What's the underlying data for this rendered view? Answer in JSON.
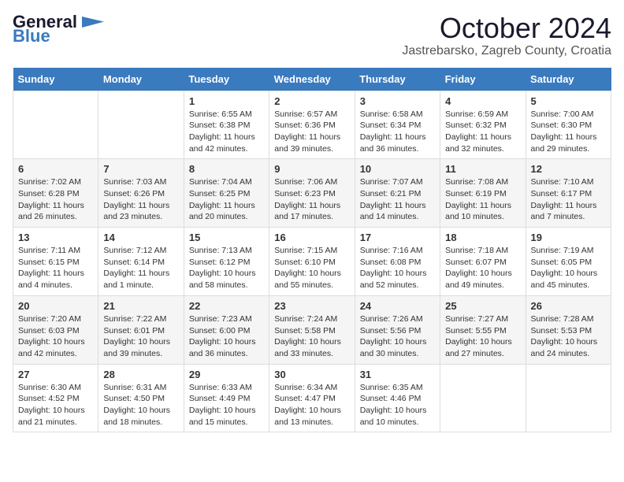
{
  "logo": {
    "line1": "General",
    "line2": "Blue"
  },
  "title": "October 2024",
  "subtitle": "Jastrebarsko, Zagreb County, Croatia",
  "days_of_week": [
    "Sunday",
    "Monday",
    "Tuesday",
    "Wednesday",
    "Thursday",
    "Friday",
    "Saturday"
  ],
  "weeks": [
    [
      {
        "day": "",
        "sunrise": "",
        "sunset": "",
        "daylight": ""
      },
      {
        "day": "",
        "sunrise": "",
        "sunset": "",
        "daylight": ""
      },
      {
        "day": "1",
        "sunrise": "Sunrise: 6:55 AM",
        "sunset": "Sunset: 6:38 PM",
        "daylight": "Daylight: 11 hours and 42 minutes."
      },
      {
        "day": "2",
        "sunrise": "Sunrise: 6:57 AM",
        "sunset": "Sunset: 6:36 PM",
        "daylight": "Daylight: 11 hours and 39 minutes."
      },
      {
        "day": "3",
        "sunrise": "Sunrise: 6:58 AM",
        "sunset": "Sunset: 6:34 PM",
        "daylight": "Daylight: 11 hours and 36 minutes."
      },
      {
        "day": "4",
        "sunrise": "Sunrise: 6:59 AM",
        "sunset": "Sunset: 6:32 PM",
        "daylight": "Daylight: 11 hours and 32 minutes."
      },
      {
        "day": "5",
        "sunrise": "Sunrise: 7:00 AM",
        "sunset": "Sunset: 6:30 PM",
        "daylight": "Daylight: 11 hours and 29 minutes."
      }
    ],
    [
      {
        "day": "6",
        "sunrise": "Sunrise: 7:02 AM",
        "sunset": "Sunset: 6:28 PM",
        "daylight": "Daylight: 11 hours and 26 minutes."
      },
      {
        "day": "7",
        "sunrise": "Sunrise: 7:03 AM",
        "sunset": "Sunset: 6:26 PM",
        "daylight": "Daylight: 11 hours and 23 minutes."
      },
      {
        "day": "8",
        "sunrise": "Sunrise: 7:04 AM",
        "sunset": "Sunset: 6:25 PM",
        "daylight": "Daylight: 11 hours and 20 minutes."
      },
      {
        "day": "9",
        "sunrise": "Sunrise: 7:06 AM",
        "sunset": "Sunset: 6:23 PM",
        "daylight": "Daylight: 11 hours and 17 minutes."
      },
      {
        "day": "10",
        "sunrise": "Sunrise: 7:07 AM",
        "sunset": "Sunset: 6:21 PM",
        "daylight": "Daylight: 11 hours and 14 minutes."
      },
      {
        "day": "11",
        "sunrise": "Sunrise: 7:08 AM",
        "sunset": "Sunset: 6:19 PM",
        "daylight": "Daylight: 11 hours and 10 minutes."
      },
      {
        "day": "12",
        "sunrise": "Sunrise: 7:10 AM",
        "sunset": "Sunset: 6:17 PM",
        "daylight": "Daylight: 11 hours and 7 minutes."
      }
    ],
    [
      {
        "day": "13",
        "sunrise": "Sunrise: 7:11 AM",
        "sunset": "Sunset: 6:15 PM",
        "daylight": "Daylight: 11 hours and 4 minutes."
      },
      {
        "day": "14",
        "sunrise": "Sunrise: 7:12 AM",
        "sunset": "Sunset: 6:14 PM",
        "daylight": "Daylight: 11 hours and 1 minute."
      },
      {
        "day": "15",
        "sunrise": "Sunrise: 7:13 AM",
        "sunset": "Sunset: 6:12 PM",
        "daylight": "Daylight: 10 hours and 58 minutes."
      },
      {
        "day": "16",
        "sunrise": "Sunrise: 7:15 AM",
        "sunset": "Sunset: 6:10 PM",
        "daylight": "Daylight: 10 hours and 55 minutes."
      },
      {
        "day": "17",
        "sunrise": "Sunrise: 7:16 AM",
        "sunset": "Sunset: 6:08 PM",
        "daylight": "Daylight: 10 hours and 52 minutes."
      },
      {
        "day": "18",
        "sunrise": "Sunrise: 7:18 AM",
        "sunset": "Sunset: 6:07 PM",
        "daylight": "Daylight: 10 hours and 49 minutes."
      },
      {
        "day": "19",
        "sunrise": "Sunrise: 7:19 AM",
        "sunset": "Sunset: 6:05 PM",
        "daylight": "Daylight: 10 hours and 45 minutes."
      }
    ],
    [
      {
        "day": "20",
        "sunrise": "Sunrise: 7:20 AM",
        "sunset": "Sunset: 6:03 PM",
        "daylight": "Daylight: 10 hours and 42 minutes."
      },
      {
        "day": "21",
        "sunrise": "Sunrise: 7:22 AM",
        "sunset": "Sunset: 6:01 PM",
        "daylight": "Daylight: 10 hours and 39 minutes."
      },
      {
        "day": "22",
        "sunrise": "Sunrise: 7:23 AM",
        "sunset": "Sunset: 6:00 PM",
        "daylight": "Daylight: 10 hours and 36 minutes."
      },
      {
        "day": "23",
        "sunrise": "Sunrise: 7:24 AM",
        "sunset": "Sunset: 5:58 PM",
        "daylight": "Daylight: 10 hours and 33 minutes."
      },
      {
        "day": "24",
        "sunrise": "Sunrise: 7:26 AM",
        "sunset": "Sunset: 5:56 PM",
        "daylight": "Daylight: 10 hours and 30 minutes."
      },
      {
        "day": "25",
        "sunrise": "Sunrise: 7:27 AM",
        "sunset": "Sunset: 5:55 PM",
        "daylight": "Daylight: 10 hours and 27 minutes."
      },
      {
        "day": "26",
        "sunrise": "Sunrise: 7:28 AM",
        "sunset": "Sunset: 5:53 PM",
        "daylight": "Daylight: 10 hours and 24 minutes."
      }
    ],
    [
      {
        "day": "27",
        "sunrise": "Sunrise: 6:30 AM",
        "sunset": "Sunset: 4:52 PM",
        "daylight": "Daylight: 10 hours and 21 minutes."
      },
      {
        "day": "28",
        "sunrise": "Sunrise: 6:31 AM",
        "sunset": "Sunset: 4:50 PM",
        "daylight": "Daylight: 10 hours and 18 minutes."
      },
      {
        "day": "29",
        "sunrise": "Sunrise: 6:33 AM",
        "sunset": "Sunset: 4:49 PM",
        "daylight": "Daylight: 10 hours and 15 minutes."
      },
      {
        "day": "30",
        "sunrise": "Sunrise: 6:34 AM",
        "sunset": "Sunset: 4:47 PM",
        "daylight": "Daylight: 10 hours and 13 minutes."
      },
      {
        "day": "31",
        "sunrise": "Sunrise: 6:35 AM",
        "sunset": "Sunset: 4:46 PM",
        "daylight": "Daylight: 10 hours and 10 minutes."
      },
      {
        "day": "",
        "sunrise": "",
        "sunset": "",
        "daylight": ""
      },
      {
        "day": "",
        "sunrise": "",
        "sunset": "",
        "daylight": ""
      }
    ]
  ]
}
